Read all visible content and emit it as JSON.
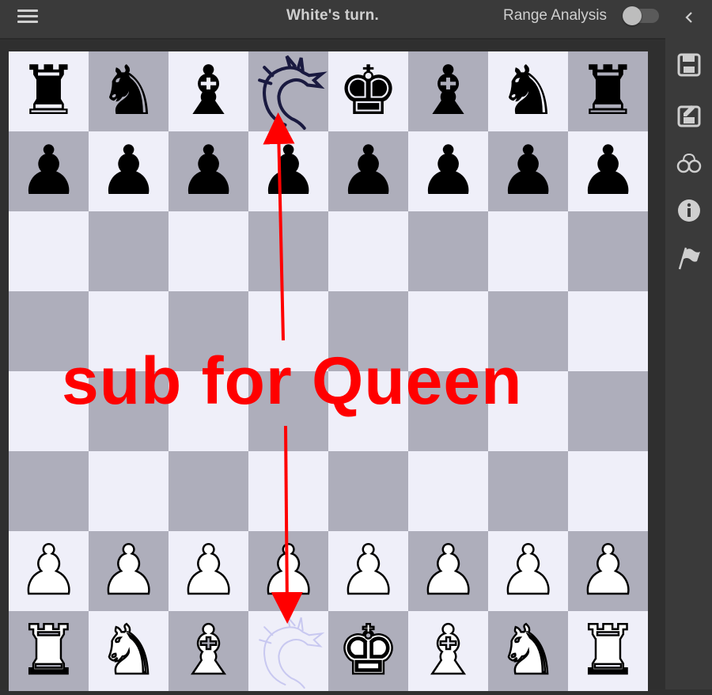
{
  "header": {
    "status_text": "White's turn.",
    "range_analysis_label": "Range Analysis",
    "range_analysis_enabled": false
  },
  "sidebar": {
    "items": [
      {
        "name": "collapse-icon"
      },
      {
        "name": "save-icon"
      },
      {
        "name": "save-edit-icon"
      },
      {
        "name": "handcuffs-icon"
      },
      {
        "name": "info-icon"
      },
      {
        "name": "flag-icon"
      }
    ]
  },
  "board": {
    "ranks": [
      [
        "bR",
        "bN",
        "bB",
        "bDragon",
        "bK",
        "bB",
        "bN",
        "bR"
      ],
      [
        "bP",
        "bP",
        "bP",
        "bP",
        "bP",
        "bP",
        "bP",
        "bP"
      ],
      [
        "",
        "",
        "",
        "",
        "",
        "",
        "",
        ""
      ],
      [
        "",
        "",
        "",
        "",
        "",
        "",
        "",
        ""
      ],
      [
        "",
        "",
        "",
        "",
        "",
        "",
        "",
        ""
      ],
      [
        "",
        "",
        "",
        "",
        "",
        "",
        "",
        ""
      ],
      [
        "wP",
        "wP",
        "wP",
        "wP",
        "wP",
        "wP",
        "wP",
        "wP"
      ],
      [
        "wR",
        "wN",
        "wB",
        "wDragon",
        "wK",
        "wB",
        "wN",
        "wR"
      ]
    ],
    "light_color": "#efeff9",
    "dark_color": "#aeaebb"
  },
  "annotation": {
    "text": "sub for Queen",
    "color": "#ff0000"
  }
}
